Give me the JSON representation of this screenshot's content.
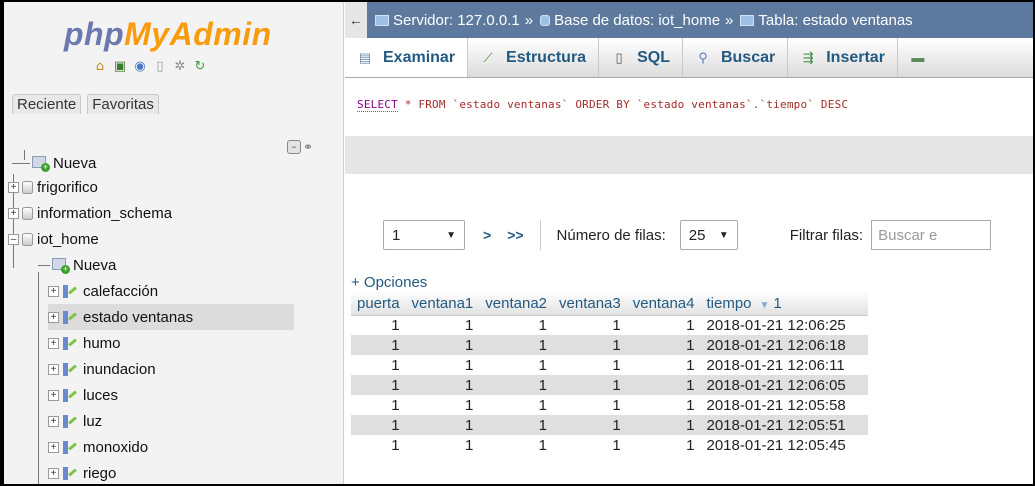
{
  "sidebar": {
    "logo_php": "php",
    "logo_my": "MyAdmin",
    "quick_icons": [
      "home-icon",
      "sql-query-icon",
      "help-icon",
      "docs-icon",
      "settings-icon",
      "reload-icon"
    ],
    "tab_recent": "Reciente",
    "tab_favorites": "Favoritas",
    "tree": [
      {
        "label": "Nueva",
        "type": "new",
        "level": 0
      },
      {
        "label": "frigorifico",
        "type": "db",
        "level": 0
      },
      {
        "label": "information_schema",
        "type": "db",
        "level": 0
      },
      {
        "label": "iot_home",
        "type": "db",
        "level": 0,
        "expanded": true
      },
      {
        "label": "Nueva",
        "type": "new",
        "level": 1
      },
      {
        "label": "calefacción",
        "type": "table",
        "level": 1
      },
      {
        "label": "estado ventanas",
        "type": "table",
        "level": 1,
        "selected": true
      },
      {
        "label": "humo",
        "type": "table",
        "level": 1
      },
      {
        "label": "inundacion",
        "type": "table",
        "level": 1
      },
      {
        "label": "luces",
        "type": "table",
        "level": 1
      },
      {
        "label": "luz",
        "type": "table",
        "level": 1
      },
      {
        "label": "monoxido",
        "type": "table",
        "level": 1
      },
      {
        "label": "riego",
        "type": "table",
        "level": 1
      }
    ]
  },
  "breadcrumb": {
    "back": "←",
    "server_label": "Servidor: 127.0.0.1",
    "db_label": "Base de datos: iot_home",
    "table_label": "Tabla: estado ventanas",
    "sep": "»"
  },
  "menu": {
    "examinar": "Examinar",
    "estructura": "Estructura",
    "sql": "SQL",
    "buscar": "Buscar",
    "insertar": "Insertar"
  },
  "query": {
    "select": "SELECT",
    "rest": " * FROM `estado ventanas` ORDER BY `estado ventanas`.`tiempo` DESC"
  },
  "navigation": {
    "page_value": "1",
    "next": ">",
    "last": ">>",
    "rows_label": "Número de filas:",
    "rows_value": "25",
    "filter_label": "Filtrar filas:",
    "filter_placeholder": "Buscar e"
  },
  "options_link": "+ Opciones",
  "table": {
    "columns": [
      "puerta",
      "ventana1",
      "ventana2",
      "ventana3",
      "ventana4",
      "tiempo"
    ],
    "sort_indicator": "1",
    "rows": [
      [
        "1",
        "1",
        "1",
        "1",
        "1",
        "2018-01-21 12:06:25"
      ],
      [
        "1",
        "1",
        "1",
        "1",
        "1",
        "2018-01-21 12:06:18"
      ],
      [
        "1",
        "1",
        "1",
        "1",
        "1",
        "2018-01-21 12:06:11"
      ],
      [
        "1",
        "1",
        "1",
        "1",
        "1",
        "2018-01-21 12:06:05"
      ],
      [
        "1",
        "1",
        "1",
        "1",
        "1",
        "2018-01-21 12:05:58"
      ],
      [
        "1",
        "1",
        "1",
        "1",
        "1",
        "2018-01-21 12:05:51"
      ],
      [
        "1",
        "1",
        "1",
        "1",
        "1",
        "2018-01-21 12:05:45"
      ]
    ]
  },
  "colors": {
    "breadcrumb_bg": "#5d7a9e",
    "link": "#235a81",
    "row_alt": "#dfdfdf"
  }
}
